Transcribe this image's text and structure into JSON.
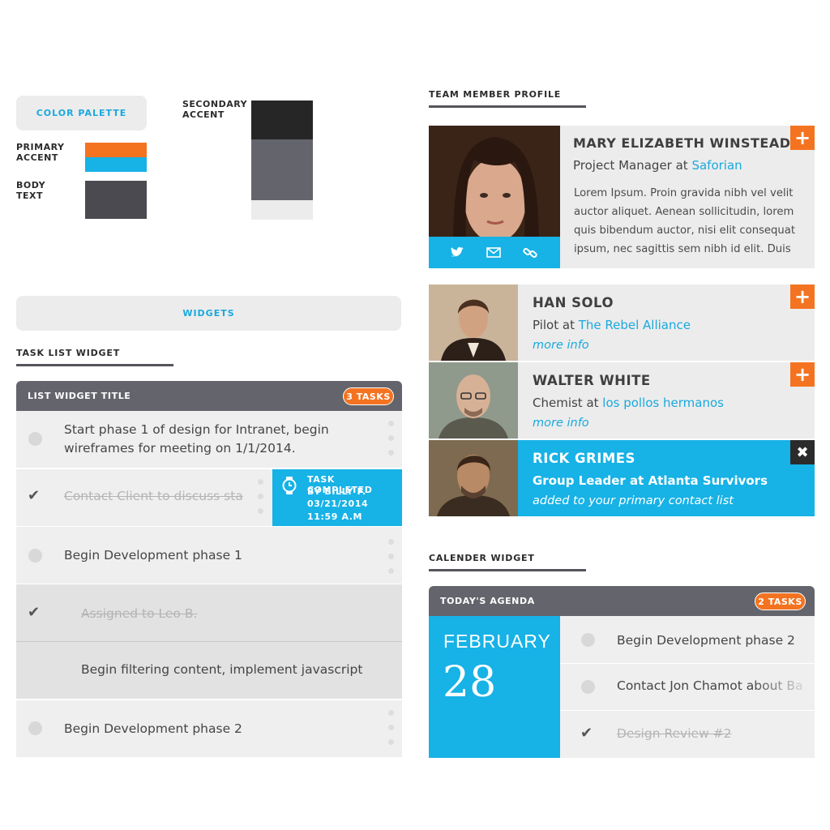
{
  "palette": {
    "button_label": "COLOR PALETTE",
    "primary_label": "PRIMARY\nACCENT",
    "body_label": "BODY\nTEXT",
    "secondary_label": "SECONDARY\nACCENT",
    "colors": {
      "primary_orange": "#f47321",
      "primary_blue": "#17b2e6",
      "body_text": "#4a4a50",
      "secondary_black": "#262626",
      "secondary_gray": "#64646c",
      "secondary_light": "#ececec"
    }
  },
  "widgets": {
    "button_label": "WIDGETS"
  },
  "task_list": {
    "section_label": "TASK LIST WIDGET",
    "title": "LIST WIDGET TITLE",
    "badge": "3 TASKS",
    "rows": [
      {
        "text": "Start phase 1 of design for Intranet, begin wireframes for meeting on 1/1/2014.",
        "done": false
      },
      {
        "text": "Contact Client to discuss sta",
        "done": true
      },
      {
        "text": "Begin Development phase 1",
        "done": false
      },
      {
        "text": "Assigned to Leo B.",
        "done": true
      },
      {
        "text": "Begin filtering content, implement javascript",
        "done": false
      },
      {
        "text": "Begin Development phase 2",
        "done": false
      }
    ],
    "toast": {
      "title": "TASK COMPLETED",
      "by": "BY BILLY F.",
      "date": "03/21/2014",
      "time": "11:59 A.M"
    }
  },
  "team_profile": {
    "section_label": "TEAM MEMBER PROFILE",
    "name": "MARY ELIZABETH WINSTEAD",
    "role_prefix": "Project Manager at ",
    "company": "Saforian",
    "bio_lines": [
      "Lorem Ipsum. Proin gravida nibh vel velit",
      "auctor aliquet. Aenean sollicitudin, lorem",
      "quis bibendum auctor, nisi elit consequat",
      "ipsum, nec sagittis sem nibh id elit. Duis"
    ],
    "social_icons": [
      "twitter-icon",
      "mail-icon",
      "link-icon"
    ]
  },
  "members": [
    {
      "name": "HAN SOLO",
      "role_prefix": "Pilot at ",
      "company": "The Rebel Alliance",
      "note": "more info",
      "action": "add"
    },
    {
      "name": "WALTER WHITE",
      "role_prefix": "Chemist at ",
      "company": "los pollos hermanos",
      "note": "more info",
      "action": "add"
    },
    {
      "name": "RICK GRIMES",
      "role_prefix": "Group Leader at ",
      "company": "Atlanta Survivors",
      "note": "added to your primary contact list",
      "action": "remove"
    }
  ],
  "calendar": {
    "section_label": "CALENDER WIDGET",
    "title": "TODAY'S AGENDA",
    "badge": "2 TASKS",
    "month": "FEBRUARY",
    "day": "28",
    "items": [
      {
        "text": "Begin Development phase 2",
        "done": false
      },
      {
        "text": "Contact Jon Chamot about Ba",
        "done": false
      },
      {
        "text": "Design Review #2",
        "done": true
      }
    ]
  }
}
